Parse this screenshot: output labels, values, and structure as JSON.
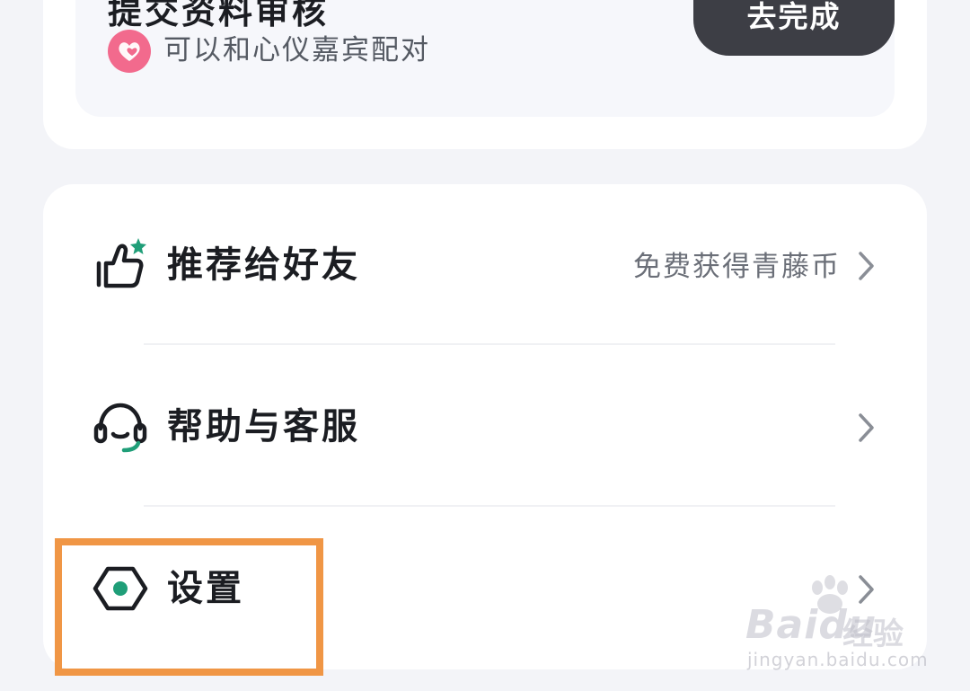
{
  "top_card": {
    "partial_title": "提交资料审核",
    "subtitle": "可以和心仪嘉宾配对",
    "action_label": "去完成"
  },
  "menu": {
    "items": [
      {
        "label": "推荐给好友",
        "extra": "免费获得青藤币",
        "icon": "thumbs-up-sparkle-icon"
      },
      {
        "label": "帮助与客服",
        "extra": "",
        "icon": "headset-icon"
      },
      {
        "label": "设置",
        "extra": "",
        "icon": "hexagon-gear-icon"
      }
    ]
  },
  "watermark": {
    "brand": "Bai",
    "brand_tail": "du",
    "brand_cn": "经验",
    "url": "jingyan.baidu.com"
  },
  "colors": {
    "accent_green": "#1f9e78",
    "button_dark": "#3d3e45",
    "heart_pink": "#f26a8d",
    "highlight_orange": "#f09645"
  }
}
